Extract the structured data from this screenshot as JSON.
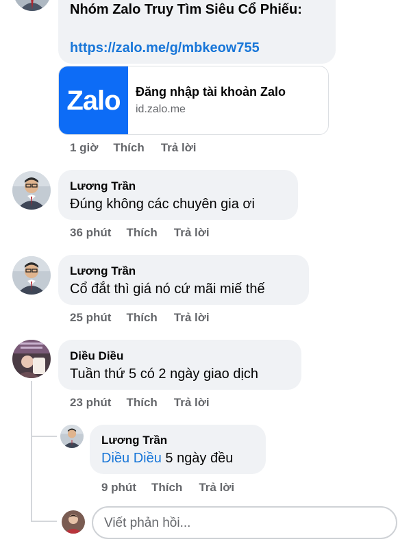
{
  "top_comment": {
    "text_line": "Nhóm Zalo Truy Tìm Siêu Cổ Phiếu:",
    "link": "https://zalo.me/g/mbkeow755",
    "preview": {
      "logo_text": "Zalo",
      "title": "Đăng nhập tài khoản Zalo",
      "domain": "id.zalo.me"
    },
    "time": "1 giờ",
    "like": "Thích",
    "reply": "Trả lời"
  },
  "comments": [
    {
      "author": "Lương Trần",
      "text": "Đúng không các chuyên gia ơi",
      "time": "36 phút",
      "like": "Thích",
      "reply": "Trả lời"
    },
    {
      "author": "Lương Trần",
      "text": "Cổ đắt thì giá nó cứ mãi miế thế",
      "time": "25 phút",
      "like": "Thích",
      "reply": "Trả lời"
    },
    {
      "author": "Diều Diều",
      "text": "Tuần thứ 5 có 2 ngày giao dịch",
      "time": "23 phút",
      "like": "Thích",
      "reply": "Trả lời"
    }
  ],
  "nested_reply": {
    "author": "Lương Trần",
    "mention": "Diều Diều",
    "text": " 5 ngày đều",
    "time": "9 phút",
    "like": "Thích",
    "reply": "Trả lời"
  },
  "reply_box": {
    "placeholder": "Viết phản hồi..."
  },
  "colors": {
    "bubble": "#f0f2f5",
    "link": "#1876d8",
    "meta": "#65676b",
    "zalo_blue": "#0d6cf6"
  }
}
